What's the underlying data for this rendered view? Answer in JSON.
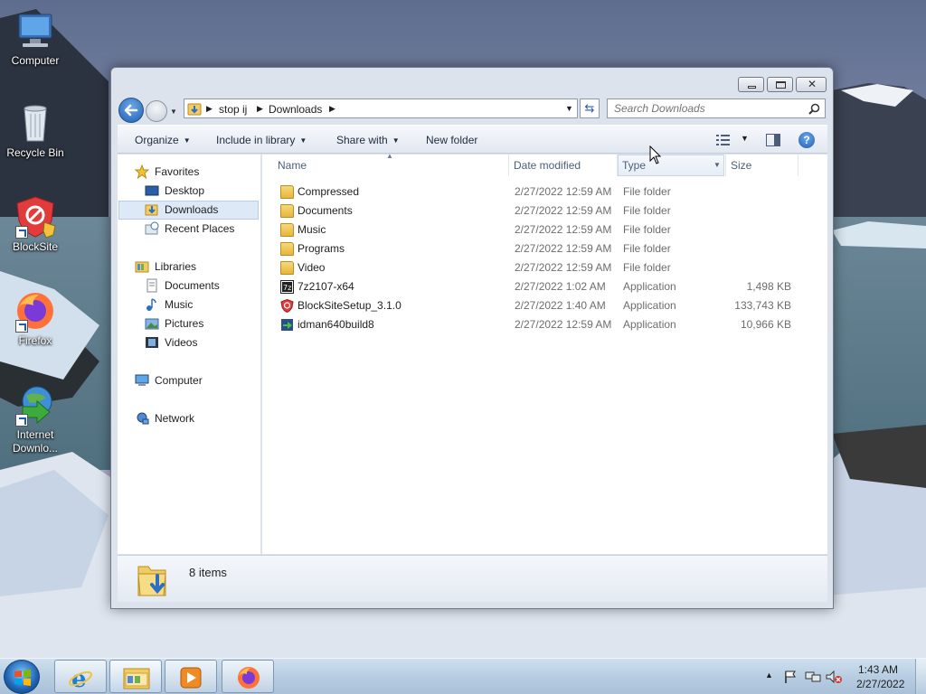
{
  "desktop": {
    "icons": [
      {
        "label": "Computer"
      },
      {
        "label": "Recycle Bin"
      },
      {
        "label": "BlockSite"
      },
      {
        "label": "Firefox"
      },
      {
        "label": "Internet Downlo..."
      }
    ]
  },
  "window": {
    "address": {
      "crumbs": [
        "stop ij",
        "Downloads"
      ]
    },
    "search": {
      "placeholder": "Search Downloads"
    },
    "toolbar": {
      "organize": "Organize",
      "include_in_library": "Include in library",
      "share_with": "Share with",
      "new_folder": "New folder"
    },
    "nav": {
      "favorites": "Favorites",
      "desktop": "Desktop",
      "downloads": "Downloads",
      "recent_places": "Recent Places",
      "libraries": "Libraries",
      "documents": "Documents",
      "music": "Music",
      "pictures": "Pictures",
      "videos": "Videos",
      "computer": "Computer",
      "network": "Network"
    },
    "columns": {
      "name": "Name",
      "date_modified": "Date modified",
      "type": "Type",
      "size": "Size"
    },
    "files": [
      {
        "name": "Compressed",
        "date": "2/27/2022 12:59 AM",
        "type": "File folder",
        "size": ""
      },
      {
        "name": "Documents",
        "date": "2/27/2022 12:59 AM",
        "type": "File folder",
        "size": ""
      },
      {
        "name": "Music",
        "date": "2/27/2022 12:59 AM",
        "type": "File folder",
        "size": ""
      },
      {
        "name": "Programs",
        "date": "2/27/2022 12:59 AM",
        "type": "File folder",
        "size": ""
      },
      {
        "name": "Video",
        "date": "2/27/2022 12:59 AM",
        "type": "File folder",
        "size": ""
      },
      {
        "name": "7z2107-x64",
        "date": "2/27/2022 1:02 AM",
        "type": "Application",
        "size": "1,498 KB"
      },
      {
        "name": "BlockSiteSetup_3.1.0",
        "date": "2/27/2022 1:40 AM",
        "type": "Application",
        "size": "133,743 KB"
      },
      {
        "name": "idman640build8",
        "date": "2/27/2022 12:59 AM",
        "type": "Application",
        "size": "10,966 KB"
      }
    ],
    "details": {
      "item_count": "8 items"
    }
  },
  "taskbar": {
    "time": "1:43 AM",
    "date": "2/27/2022"
  },
  "colors": {
    "accent": "#1c5fb4",
    "selection": "#dde9f7",
    "taskbar": "#b8cde2"
  }
}
